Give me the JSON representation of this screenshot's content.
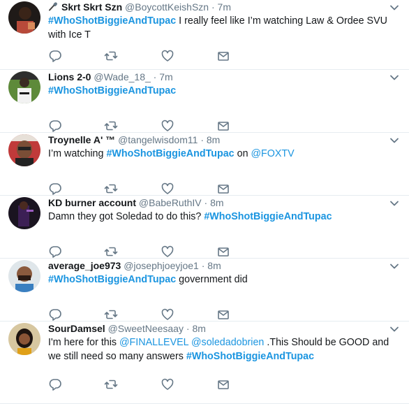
{
  "colors": {
    "link": "#1b95e0",
    "muted": "#657786",
    "text": "#14171a",
    "divider": "#e6ecf0"
  },
  "tweets": [
    {
      "name": "Skrt Skrt Szn",
      "handle": "@BoycottKeishSzn",
      "time": "7m",
      "segments": [
        {
          "t": "#WhoShotBiggieAndTupac",
          "k": "hashtag"
        },
        {
          "t": " I really feel like I’m watching Law & Ordee SVU with Ice T",
          "k": "plain"
        }
      ]
    },
    {
      "name": "Lions 2-0",
      "handle": "@Wade_18_",
      "time": "7m",
      "segments": [
        {
          "t": "#WhoShotBiggieAndTupac",
          "k": "hashtag"
        }
      ]
    },
    {
      "name": "Troynelle A' ™",
      "handle": "@tangelwisdom11",
      "time": "8m",
      "segments": [
        {
          "t": "I’m watching ",
          "k": "plain"
        },
        {
          "t": "#WhoShotBiggieAndTupac",
          "k": "hashtag"
        },
        {
          "t": " on ",
          "k": "plain"
        },
        {
          "t": "@FOXTV",
          "k": "mention"
        }
      ]
    },
    {
      "name": "KD burner account",
      "handle": "@BabeRuthIV",
      "time": "8m",
      "segments": [
        {
          "t": "Damn they got Soledad to do this? ",
          "k": "plain"
        },
        {
          "t": "#WhoShotBiggieAndTupac",
          "k": "hashtag"
        }
      ]
    },
    {
      "name": "average_joe973",
      "handle": "@josephjoeyjoe1",
      "time": "8m",
      "segments": [
        {
          "t": "#WhoShotBiggieAndTupac",
          "k": "hashtag"
        },
        {
          "t": " government did",
          "k": "plain"
        }
      ]
    },
    {
      "name": "SourDamsel",
      "handle": "@SweetNeesaay",
      "time": "8m",
      "segments": [
        {
          "t": "I'm here for this ",
          "k": "plain"
        },
        {
          "t": "@FINALLEVEL",
          "k": "mention"
        },
        {
          "t": " ",
          "k": "plain"
        },
        {
          "t": "@soledadobrien",
          "k": "mention"
        },
        {
          "t": " .This Should be GOOD and we still need so many answers ",
          "k": "plain"
        },
        {
          "t": "#WhoShotBiggieAndTupac",
          "k": "hashtag"
        }
      ]
    }
  ],
  "dot": "·",
  "icons": [
    "microphone-icon",
    "chevron-down-icon",
    "reply-icon",
    "retweet-icon",
    "like-icon",
    "direct-message-icon"
  ]
}
